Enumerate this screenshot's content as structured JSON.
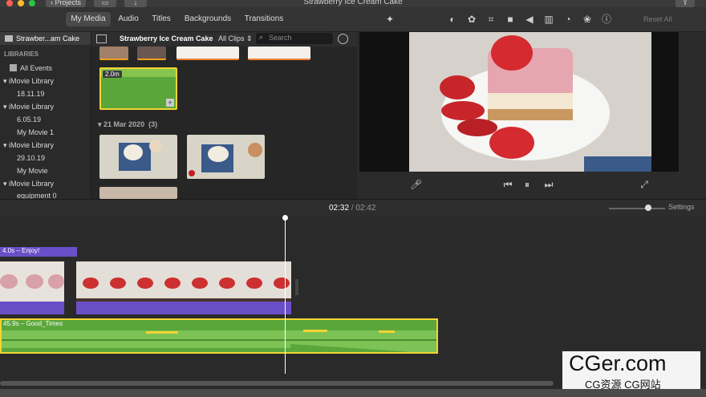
{
  "window": {
    "title": "Strawberry Ice Cream Cake",
    "projects_label": "Projects"
  },
  "media_tabs": [
    "My Media",
    "Audio",
    "Titles",
    "Backgrounds",
    "Transitions"
  ],
  "viewer_tools": {
    "reset_all": "Reset All"
  },
  "sidebar": {
    "project_name": "Strawber...am Cake",
    "libraries_header": "LIBRARIES",
    "items": [
      {
        "label": "All Events"
      },
      {
        "label": "iMovie Library"
      },
      {
        "label": "18.11.19"
      },
      {
        "label": "iMovie Library"
      },
      {
        "label": "6.05.19"
      },
      {
        "label": "My Movie 1"
      },
      {
        "label": "iMovie Library"
      },
      {
        "label": "29.10.19"
      },
      {
        "label": "My Movie"
      },
      {
        "label": "iMovie Library"
      },
      {
        "label": "equipment 0"
      }
    ]
  },
  "browser": {
    "library_title": "Strawberry Ice Cream Cake",
    "filter": "All Clips",
    "search_placeholder": "Search",
    "selected_clip_duration": "2.0m",
    "group_date": "21 Mar 2020",
    "group_count": "(3)"
  },
  "timeline": {
    "current_time": "02:32",
    "separator": "/",
    "total_time": "02:42",
    "settings_label": "Settings",
    "zoom_level": 0.7,
    "title_clip_label": "4.0s – Enjoy!",
    "audio_clip_label": "45.9s – Good_Times"
  },
  "watermark": {
    "big": "CGer.com",
    "small": "CG资源 CG网站"
  },
  "colors": {
    "accent_purple": "#6a4fc8",
    "audio_green": "#5aa63a",
    "clip_highlight": "#f2d434",
    "playhead": "#ffffff"
  }
}
